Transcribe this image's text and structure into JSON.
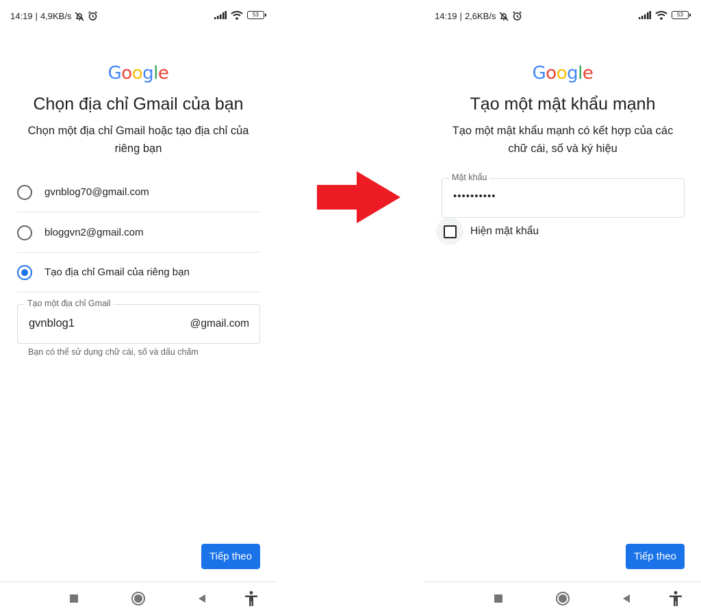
{
  "left": {
    "status": {
      "time": "14:19",
      "speed": "4,9KB/s",
      "battery": "53"
    },
    "logo": "Google",
    "title": "Chọn địa chỉ Gmail của bạn",
    "subtitle": "Chọn một địa chỉ Gmail hoặc tạo địa chỉ của riêng bạn",
    "options": [
      {
        "label": "gvnblog70@gmail.com",
        "checked": false
      },
      {
        "label": "bloggvn2@gmail.com",
        "checked": false
      },
      {
        "label": "Tạo địa chỉ Gmail của riêng bạn",
        "checked": true
      }
    ],
    "field": {
      "label": "Tạo một địa chỉ Gmail",
      "value": "gvnblog1",
      "suffix": "@gmail.com"
    },
    "helper": "Bạn có thể sử dụng chữ cái, số và dấu chấm",
    "next_button": "Tiếp theo"
  },
  "right": {
    "status": {
      "time": "14:19",
      "speed": "2,6KB/s",
      "battery": "53"
    },
    "logo": "Google",
    "title": "Tạo một mật khẩu mạnh",
    "subtitle": "Tạo một mật khẩu mạnh có kết hợp của các chữ cái, số và ký hiệu",
    "field": {
      "label": "Mật khẩu",
      "value": "••••••••••"
    },
    "show_password": "Hiện mật khẩu",
    "next_button": "Tiếp theo"
  },
  "colors": {
    "accent": "#1a73e8",
    "arrow": "#ed1c24",
    "google_blue": "#4285f4",
    "google_red": "#ea4335",
    "google_yellow": "#fbbc05",
    "google_green": "#34a853"
  },
  "icons": {
    "arrow": "right-arrow-icon",
    "nav": [
      "recent-apps-icon",
      "home-icon",
      "back-icon",
      "accessibility-icon"
    ],
    "status": [
      "mute-icon",
      "alarm-icon",
      "signal-icon",
      "wifi-icon",
      "battery-icon"
    ]
  }
}
